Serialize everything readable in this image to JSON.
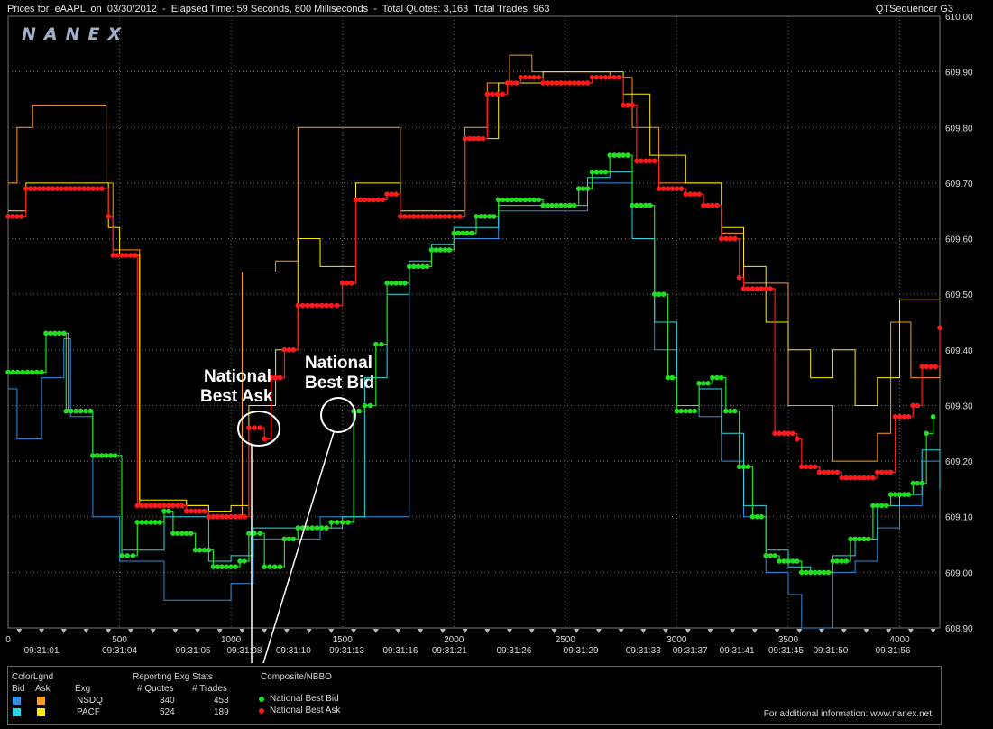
{
  "header": {
    "title": "Prices for  eAAPL  on  03/30/2012  -  Elapsed Time: 59 Seconds, 800 Milliseconds  -  Total Quotes: 3,163  Total Trades: 963",
    "app_name": "QTSequencer G3"
  },
  "logo": "NANEX",
  "annotations": {
    "ask_line1": "National",
    "ask_line2": "Best Ask",
    "bid_line1": "National",
    "bid_line2": "Best Bid"
  },
  "colors": {
    "nsdq_bid": "#2f8fe0",
    "nsdq_ask": "#ff9a1a",
    "pacf_bid": "#29d9e8",
    "pacf_ask": "#ffee00",
    "nbb": "#22dd22",
    "nbo": "#ff1a1a"
  },
  "legend": {
    "colorlgnd": "ColorLgnd",
    "bid": "Bid",
    "ask": "Ask",
    "exg": "Exg",
    "reporting": "Reporting Exg Stats",
    "quotes_hdr": "# Quotes",
    "trades_hdr": "# Trades",
    "composite": "Composite/NBBO",
    "nbb_label": "National Best Bid",
    "nbo_label": "National Best Ask",
    "rows": [
      {
        "exg": "NSDQ",
        "quotes": "340",
        "trades": "453"
      },
      {
        "exg": "PACF",
        "quotes": "524",
        "trades": "189"
      }
    ],
    "info": "For additional information: www.nanex.net"
  },
  "chart_data": {
    "type": "line",
    "x_ticks": [
      {
        "v": 0,
        "label": "0"
      },
      {
        "v": 500,
        "label": "500"
      },
      {
        "v": 1000,
        "label": "1000"
      },
      {
        "v": 1500,
        "label": "1500"
      },
      {
        "v": 2000,
        "label": "2000"
      },
      {
        "v": 2500,
        "label": "2500"
      },
      {
        "v": 3000,
        "label": "3000"
      },
      {
        "v": 3500,
        "label": "3500"
      },
      {
        "v": 4000,
        "label": "4000"
      }
    ],
    "time_labels": [
      {
        "v": 150,
        "label": "09:31:01"
      },
      {
        "v": 500,
        "label": "09:31:04"
      },
      {
        "v": 830,
        "label": "09:31:05"
      },
      {
        "v": 1060,
        "label": "09:31:08"
      },
      {
        "v": 1280,
        "label": "09:31:10"
      },
      {
        "v": 1520,
        "label": "09:31:13"
      },
      {
        "v": 1760,
        "label": "09:31:16"
      },
      {
        "v": 1980,
        "label": "09:31:21"
      },
      {
        "v": 2270,
        "label": "09:31:26"
      },
      {
        "v": 2570,
        "label": "09:31:29"
      },
      {
        "v": 2850,
        "label": "09:31:33"
      },
      {
        "v": 3060,
        "label": "09:31:37"
      },
      {
        "v": 3270,
        "label": "09:31:41"
      },
      {
        "v": 3490,
        "label": "09:31:45"
      },
      {
        "v": 3690,
        "label": "09:31:50"
      },
      {
        "v": 3970,
        "label": "09:31:56"
      }
    ],
    "y_ticks": [
      "608.90",
      "609.00",
      "609.10",
      "609.20",
      "609.30",
      "609.40",
      "609.50",
      "609.60",
      "609.70",
      "609.80",
      "609.90",
      "610.00"
    ],
    "xlim": [
      0,
      4180
    ],
    "ylim": [
      608.9,
      610.0
    ],
    "grid": true,
    "series": [
      {
        "name": "National Best Ask",
        "color": "#ff1a1a",
        "points": [
          [
            0,
            609.64
          ],
          [
            80,
            609.69
          ],
          [
            420,
            609.69
          ],
          [
            450,
            609.64
          ],
          [
            470,
            609.57
          ],
          [
            570,
            609.57
          ],
          [
            580,
            609.12
          ],
          [
            680,
            609.12
          ],
          [
            800,
            609.11
          ],
          [
            900,
            609.1
          ],
          [
            1000,
            609.1
          ],
          [
            1080,
            609.26
          ],
          [
            1130,
            609.26
          ],
          [
            1150,
            609.24
          ],
          [
            1180,
            609.35
          ],
          [
            1240,
            609.4
          ],
          [
            1300,
            609.48
          ],
          [
            1450,
            609.48
          ],
          [
            1500,
            609.52
          ],
          [
            1560,
            609.67
          ],
          [
            1700,
            609.68
          ],
          [
            1760,
            609.64
          ],
          [
            1980,
            609.64
          ],
          [
            2050,
            609.78
          ],
          [
            2150,
            609.86
          ],
          [
            2240,
            609.88
          ],
          [
            2300,
            609.89
          ],
          [
            2400,
            609.88
          ],
          [
            2560,
            609.88
          ],
          [
            2620,
            609.89
          ],
          [
            2700,
            609.89
          ],
          [
            2760,
            609.84
          ],
          [
            2820,
            609.74
          ],
          [
            2920,
            609.69
          ],
          [
            3040,
            609.68
          ],
          [
            3120,
            609.66
          ],
          [
            3200,
            609.6
          ],
          [
            3280,
            609.53
          ],
          [
            3300,
            609.51
          ],
          [
            3400,
            609.51
          ],
          [
            3440,
            609.25
          ],
          [
            3540,
            609.24
          ],
          [
            3560,
            609.19
          ],
          [
            3640,
            609.18
          ],
          [
            3740,
            609.17
          ],
          [
            3900,
            609.18
          ],
          [
            3980,
            609.28
          ],
          [
            4060,
            609.3
          ],
          [
            4100,
            609.37
          ],
          [
            4180,
            609.44
          ]
        ]
      },
      {
        "name": "National Best Bid",
        "color": "#22dd22",
        "points": [
          [
            0,
            609.36
          ],
          [
            150,
            609.36
          ],
          [
            170,
            609.43
          ],
          [
            250,
            609.43
          ],
          [
            260,
            609.29
          ],
          [
            370,
            609.29
          ],
          [
            380,
            609.21
          ],
          [
            480,
            609.21
          ],
          [
            510,
            609.03
          ],
          [
            560,
            609.03
          ],
          [
            580,
            609.09
          ],
          [
            700,
            609.11
          ],
          [
            740,
            609.07
          ],
          [
            840,
            609.04
          ],
          [
            920,
            609.01
          ],
          [
            1040,
            609.02
          ],
          [
            1080,
            609.07
          ],
          [
            1130,
            609.07
          ],
          [
            1150,
            609.01
          ],
          [
            1220,
            609.01
          ],
          [
            1240,
            609.06
          ],
          [
            1300,
            609.08
          ],
          [
            1450,
            609.09
          ],
          [
            1500,
            609.09
          ],
          [
            1550,
            609.29
          ],
          [
            1600,
            609.3
          ],
          [
            1650,
            609.41
          ],
          [
            1700,
            609.52
          ],
          [
            1800,
            609.55
          ],
          [
            1900,
            609.58
          ],
          [
            2000,
            609.61
          ],
          [
            2100,
            609.64
          ],
          [
            2200,
            609.67
          ],
          [
            2300,
            609.67
          ],
          [
            2400,
            609.66
          ],
          [
            2500,
            609.66
          ],
          [
            2560,
            609.69
          ],
          [
            2620,
            609.72
          ],
          [
            2700,
            609.75
          ],
          [
            2800,
            609.66
          ],
          [
            2900,
            609.5
          ],
          [
            2960,
            609.35
          ],
          [
            3000,
            609.29
          ],
          [
            3100,
            609.34
          ],
          [
            3160,
            609.35
          ],
          [
            3220,
            609.29
          ],
          [
            3280,
            609.19
          ],
          [
            3340,
            609.1
          ],
          [
            3400,
            609.03
          ],
          [
            3460,
            609.02
          ],
          [
            3560,
            609.0
          ],
          [
            3700,
            609.02
          ],
          [
            3780,
            609.06
          ],
          [
            3880,
            609.12
          ],
          [
            3960,
            609.14
          ],
          [
            4060,
            609.16
          ],
          [
            4120,
            609.25
          ],
          [
            4150,
            609.28
          ]
        ]
      },
      {
        "name": "NSDQ Ask",
        "color": "#ff9a1a",
        "points": [
          [
            0,
            609.7
          ],
          [
            40,
            609.8
          ],
          [
            110,
            609.84
          ],
          [
            420,
            609.84
          ],
          [
            440,
            609.7
          ],
          [
            470,
            609.58
          ],
          [
            580,
            609.58
          ],
          [
            590,
            609.12
          ],
          [
            700,
            609.12
          ],
          [
            800,
            609.12
          ],
          [
            900,
            609.1
          ],
          [
            1050,
            609.54
          ],
          [
            1200,
            609.56
          ],
          [
            1300,
            609.8
          ],
          [
            1500,
            609.8
          ],
          [
            1600,
            609.8
          ],
          [
            1760,
            609.64
          ],
          [
            1980,
            609.64
          ],
          [
            2050,
            609.8
          ],
          [
            2150,
            609.88
          ],
          [
            2250,
            609.93
          ],
          [
            2350,
            609.9
          ],
          [
            2550,
            609.9
          ],
          [
            2700,
            609.89
          ],
          [
            2800,
            609.8
          ],
          [
            2920,
            609.7
          ],
          [
            3040,
            609.7
          ],
          [
            3200,
            609.61
          ],
          [
            3300,
            609.52
          ],
          [
            3400,
            609.52
          ],
          [
            3500,
            609.3
          ],
          [
            3700,
            609.2
          ],
          [
            3900,
            609.25
          ],
          [
            3960,
            609.45
          ],
          [
            4050,
            609.35
          ],
          [
            4180,
            609.4
          ]
        ]
      },
      {
        "name": "PACF Ask",
        "color": "#ffee00",
        "points": [
          [
            0,
            609.65
          ],
          [
            80,
            609.7
          ],
          [
            420,
            609.7
          ],
          [
            450,
            609.62
          ],
          [
            500,
            609.57
          ],
          [
            580,
            609.57
          ],
          [
            590,
            609.13
          ],
          [
            700,
            609.13
          ],
          [
            800,
            609.12
          ],
          [
            900,
            609.11
          ],
          [
            1000,
            609.12
          ],
          [
            1080,
            609.3
          ],
          [
            1200,
            609.4
          ],
          [
            1300,
            609.6
          ],
          [
            1400,
            609.55
          ],
          [
            1500,
            609.55
          ],
          [
            1560,
            609.7
          ],
          [
            1760,
            609.65
          ],
          [
            1980,
            609.65
          ],
          [
            2050,
            609.78
          ],
          [
            2200,
            609.88
          ],
          [
            2400,
            609.9
          ],
          [
            2600,
            609.9
          ],
          [
            2760,
            609.86
          ],
          [
            2880,
            609.75
          ],
          [
            3040,
            609.7
          ],
          [
            3200,
            609.62
          ],
          [
            3300,
            609.55
          ],
          [
            3400,
            609.45
          ],
          [
            3500,
            609.4
          ],
          [
            3600,
            609.35
          ],
          [
            3700,
            609.4
          ],
          [
            3800,
            609.3
          ],
          [
            3900,
            609.35
          ],
          [
            4000,
            609.49
          ],
          [
            4100,
            609.49
          ],
          [
            4180,
            609.49
          ]
        ]
      },
      {
        "name": "NSDQ Bid",
        "color": "#2f8fe0",
        "points": [
          [
            0,
            609.33
          ],
          [
            40,
            609.24
          ],
          [
            100,
            609.24
          ],
          [
            150,
            609.35
          ],
          [
            250,
            609.42
          ],
          [
            280,
            609.28
          ],
          [
            370,
            609.28
          ],
          [
            380,
            609.1
          ],
          [
            480,
            609.1
          ],
          [
            500,
            609.02
          ],
          [
            580,
            609.02
          ],
          [
            700,
            608.95
          ],
          [
            900,
            608.95
          ],
          [
            1000,
            608.98
          ],
          [
            1100,
            609.06
          ],
          [
            1300,
            609.06
          ],
          [
            1400,
            609.1
          ],
          [
            1600,
            609.1
          ],
          [
            1700,
            609.1
          ],
          [
            1800,
            609.55
          ],
          [
            1900,
            609.58
          ],
          [
            2000,
            609.6
          ],
          [
            2200,
            609.65
          ],
          [
            2500,
            609.65
          ],
          [
            2600,
            609.7
          ],
          [
            2700,
            609.7
          ],
          [
            2800,
            609.6
          ],
          [
            2900,
            609.4
          ],
          [
            3000,
            609.3
          ],
          [
            3100,
            609.28
          ],
          [
            3200,
            609.2
          ],
          [
            3300,
            609.1
          ],
          [
            3400,
            609.0
          ],
          [
            3500,
            608.96
          ],
          [
            3560,
            608.9
          ],
          [
            3700,
            609.0
          ],
          [
            3800,
            609.02
          ],
          [
            3900,
            609.08
          ],
          [
            4000,
            609.12
          ],
          [
            4100,
            609.2
          ],
          [
            4180,
            609.2
          ]
        ]
      },
      {
        "name": "PACF Bid",
        "color": "#29d9e8",
        "points": [
          [
            0,
            609.36
          ],
          [
            150,
            609.36
          ],
          [
            170,
            609.43
          ],
          [
            250,
            609.43
          ],
          [
            270,
            609.29
          ],
          [
            370,
            609.29
          ],
          [
            380,
            609.21
          ],
          [
            480,
            609.21
          ],
          [
            510,
            609.04
          ],
          [
            580,
            609.04
          ],
          [
            700,
            609.1
          ],
          [
            800,
            609.1
          ],
          [
            900,
            609.02
          ],
          [
            1000,
            609.03
          ],
          [
            1100,
            609.08
          ],
          [
            1300,
            609.08
          ],
          [
            1500,
            609.1
          ],
          [
            1600,
            609.35
          ],
          [
            1700,
            609.5
          ],
          [
            1800,
            609.56
          ],
          [
            1900,
            609.59
          ],
          [
            2000,
            609.62
          ],
          [
            2200,
            609.66
          ],
          [
            2500,
            609.66
          ],
          [
            2600,
            609.71
          ],
          [
            2700,
            609.72
          ],
          [
            2800,
            609.6
          ],
          [
            2900,
            609.45
          ],
          [
            3000,
            609.3
          ],
          [
            3100,
            609.33
          ],
          [
            3200,
            609.25
          ],
          [
            3300,
            609.12
          ],
          [
            3400,
            609.04
          ],
          [
            3500,
            609.01
          ],
          [
            3600,
            609.0
          ],
          [
            3700,
            609.03
          ],
          [
            3800,
            609.06
          ],
          [
            3900,
            609.12
          ],
          [
            4000,
            609.14
          ],
          [
            4100,
            609.22
          ],
          [
            4180,
            609.15
          ]
        ]
      }
    ]
  }
}
